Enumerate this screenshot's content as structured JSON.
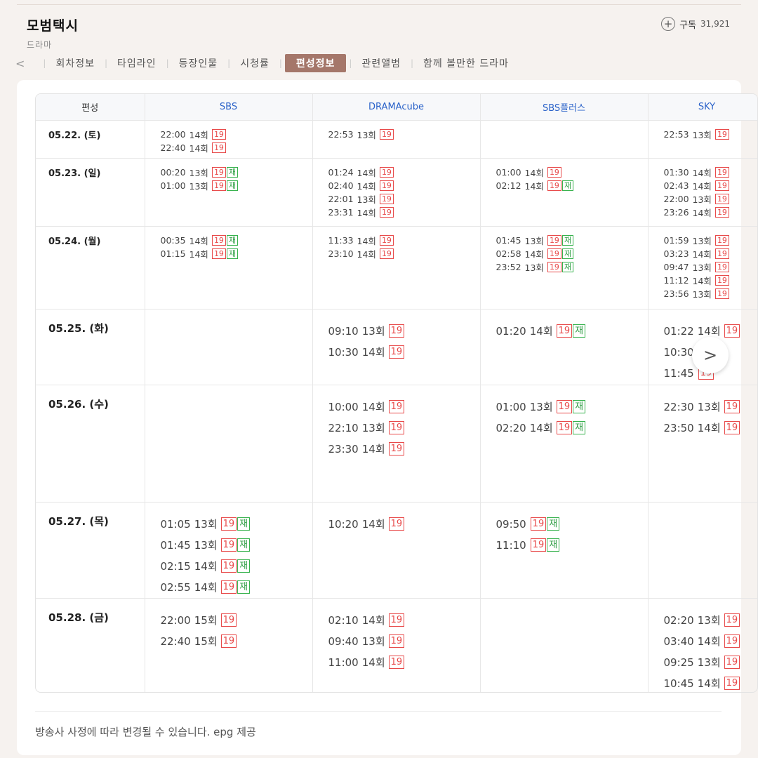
{
  "header": {
    "title": "모범택시",
    "category": "드라마",
    "subscribe_label": "구독",
    "subscribe_count": "31,921"
  },
  "tabs": {
    "prev": "<",
    "items": [
      "회차정보",
      "타임라인",
      "등장인물",
      "시청률",
      "편성정보",
      "관련앨범",
      "함께 볼만한 드라마"
    ],
    "active_index": 4
  },
  "schedule": {
    "date_header": "편성",
    "channels": [
      "SBS",
      "DRAMAcube",
      "SBS플러스",
      "SKY"
    ],
    "rows": [
      {
        "date": "05.22. (토)",
        "cells": [
          [
            {
              "time": "22:00",
              "ep": "14회",
              "rerun": false
            },
            {
              "time": "22:40",
              "ep": "14회",
              "rerun": false
            }
          ],
          [
            {
              "time": "22:53",
              "ep": "13회",
              "rerun": false
            }
          ],
          [],
          [
            {
              "time": "22:53",
              "ep": "13회",
              "rerun": false
            }
          ]
        ]
      },
      {
        "date": "05.23. (일)",
        "cells": [
          [
            {
              "time": "00:20",
              "ep": "13회",
              "rerun": true
            },
            {
              "time": "01:00",
              "ep": "13회",
              "rerun": true
            }
          ],
          [
            {
              "time": "01:24",
              "ep": "14회",
              "rerun": false
            },
            {
              "time": "02:40",
              "ep": "14회",
              "rerun": false
            },
            {
              "time": "22:01",
              "ep": "13회",
              "rerun": false
            },
            {
              "time": "23:31",
              "ep": "14회",
              "rerun": false
            }
          ],
          [
            {
              "time": "01:00",
              "ep": "14회",
              "rerun": false
            },
            {
              "time": "02:12",
              "ep": "14회",
              "rerun": true
            }
          ],
          [
            {
              "time": "01:30",
              "ep": "14회",
              "rerun": false
            },
            {
              "time": "02:43",
              "ep": "14회",
              "rerun": false
            },
            {
              "time": "22:00",
              "ep": "13회",
              "rerun": false
            },
            {
              "time": "23:26",
              "ep": "14회",
              "rerun": false
            }
          ]
        ]
      },
      {
        "date": "05.24. (월)",
        "cells": [
          [
            {
              "time": "00:35",
              "ep": "14회",
              "rerun": true
            },
            {
              "time": "01:15",
              "ep": "14회",
              "rerun": true
            }
          ],
          [
            {
              "time": "11:33",
              "ep": "14회",
              "rerun": false
            },
            {
              "time": "23:10",
              "ep": "14회",
              "rerun": false
            }
          ],
          [
            {
              "time": "01:45",
              "ep": "13회",
              "rerun": true
            },
            {
              "time": "02:58",
              "ep": "14회",
              "rerun": true
            },
            {
              "time": "23:52",
              "ep": "13회",
              "rerun": true
            }
          ],
          [
            {
              "time": "01:59",
              "ep": "13회",
              "rerun": false
            },
            {
              "time": "03:23",
              "ep": "14회",
              "rerun": false
            },
            {
              "time": "09:47",
              "ep": "13회",
              "rerun": false
            },
            {
              "time": "11:12",
              "ep": "14회",
              "rerun": false
            },
            {
              "time": "23:56",
              "ep": "13회",
              "rerun": false
            }
          ]
        ]
      },
      {
        "date": "05.25. (화)",
        "cells": [
          [],
          [
            {
              "time": "09:10",
              "ep": "13회",
              "rerun": false
            },
            {
              "time": "10:30",
              "ep": "14회",
              "rerun": false
            }
          ],
          [
            {
              "time": "01:20",
              "ep": "14회",
              "rerun": true
            }
          ],
          [
            {
              "time": "01:22",
              "ep": "14회",
              "rerun": false
            },
            {
              "time": "10:30",
              "ep": "",
              "rerun": false
            },
            {
              "time": "11:45",
              "ep": "",
              "rerun": false
            }
          ]
        ]
      },
      {
        "date": "05.26. (수)",
        "cells": [
          [],
          [
            {
              "time": "10:00",
              "ep": "14회",
              "rerun": false
            },
            {
              "time": "22:10",
              "ep": "13회",
              "rerun": false
            },
            {
              "time": "23:30",
              "ep": "14회",
              "rerun": false
            }
          ],
          [
            {
              "time": "01:00",
              "ep": "13회",
              "rerun": true
            },
            {
              "time": "02:20",
              "ep": "14회",
              "rerun": true
            }
          ],
          [
            {
              "time": "22:30",
              "ep": "13회",
              "rerun": false
            },
            {
              "time": "23:50",
              "ep": "14회",
              "rerun": false
            }
          ]
        ]
      },
      {
        "date": "05.27. (목)",
        "cells": [
          [
            {
              "time": "01:05",
              "ep": "13회",
              "rerun": true
            },
            {
              "time": "01:45",
              "ep": "13회",
              "rerun": true
            },
            {
              "time": "02:15",
              "ep": "14회",
              "rerun": true
            },
            {
              "time": "02:55",
              "ep": "14회",
              "rerun": true
            }
          ],
          [
            {
              "time": "10:20",
              "ep": "14회",
              "rerun": false
            }
          ],
          [
            {
              "time": "09:50",
              "ep": "",
              "rerun": true
            },
            {
              "time": "11:10",
              "ep": "",
              "rerun": true
            }
          ],
          []
        ]
      },
      {
        "date": "05.28. (금)",
        "cells": [
          [
            {
              "time": "22:00",
              "ep": "15회",
              "rerun": false
            },
            {
              "time": "22:40",
              "ep": "15회",
              "rerun": false
            }
          ],
          [
            {
              "time": "02:10",
              "ep": "14회",
              "rerun": false
            },
            {
              "time": "09:40",
              "ep": "13회",
              "rerun": false
            },
            {
              "time": "11:00",
              "ep": "14회",
              "rerun": false
            }
          ],
          [],
          [
            {
              "time": "02:20",
              "ep": "13회",
              "rerun": false
            },
            {
              "time": "03:40",
              "ep": "14회",
              "rerun": false
            },
            {
              "time": "09:25",
              "ep": "13회",
              "rerun": false
            },
            {
              "time": "10:45",
              "ep": "14회",
              "rerun": false
            }
          ]
        ]
      }
    ],
    "rating_badge": "19",
    "rerun_badge": "재"
  },
  "next_icon": "chevron-right-icon",
  "next_glyph": ">",
  "footer": {
    "notice": "방송사 사정에 따라 변경될 수 있습니다. epg 제공"
  },
  "colors": {
    "accent": "#a5776a",
    "channel_link": "#2a62c9",
    "rating_red": "#e84a4a",
    "rerun_green": "#2f9e44"
  }
}
